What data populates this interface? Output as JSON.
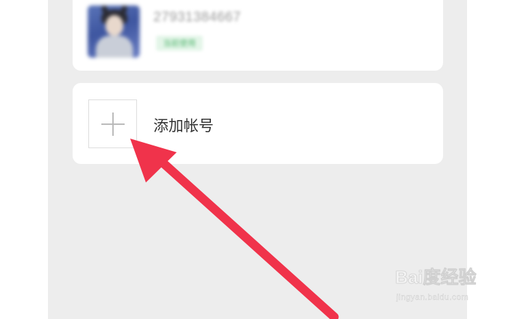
{
  "account": {
    "id_text": "27931384667",
    "status_text": "当前使用"
  },
  "add_account": {
    "label": "添加帐号",
    "icon": "plus-icon"
  },
  "watermark": {
    "logo_text": "Bai度经验",
    "sub_text": "jingyan.baidu.com"
  },
  "colors": {
    "page_bg": "#ededed",
    "card_bg": "#ffffff",
    "arrow": "#f0334b",
    "status_green": "#59b874"
  }
}
